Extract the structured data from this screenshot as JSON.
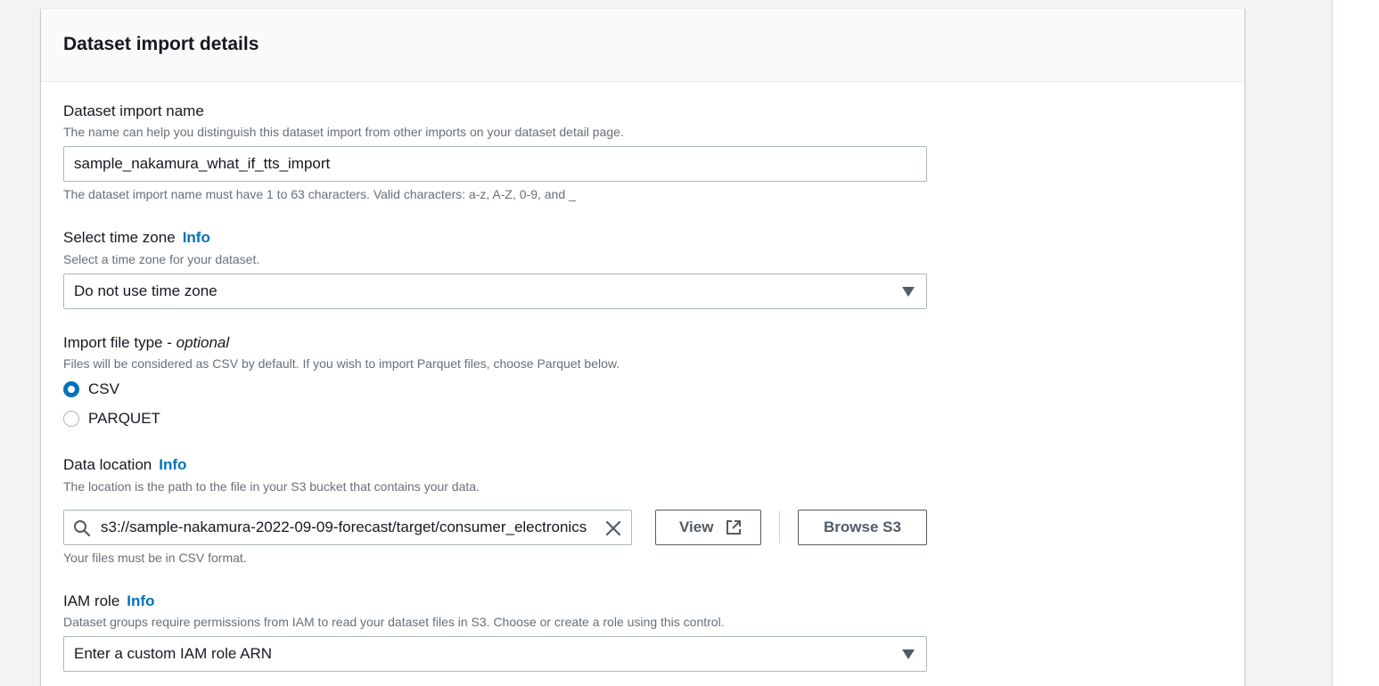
{
  "section": {
    "title": "Dataset import details"
  },
  "import_name": {
    "label": "Dataset import name",
    "description": "The name can help you distinguish this dataset import from other imports on your dataset detail page.",
    "value": "sample_nakamura_what_if_tts_import",
    "constraint": "The dataset import name must have 1 to 63 characters. Valid characters: a-z, A-Z, 0-9, and _"
  },
  "time_zone": {
    "label": "Select time zone",
    "info": "Info",
    "description": "Select a time zone for your dataset.",
    "selected": "Do not use time zone"
  },
  "file_type": {
    "label": "Import file type",
    "optional_dash": " - ",
    "optional": "optional",
    "description": "Files will be considered as CSV by default. If you wish to import Parquet files, choose Parquet below.",
    "options": [
      {
        "label": "CSV",
        "checked": true
      },
      {
        "label": "PARQUET",
        "checked": false
      }
    ]
  },
  "data_location": {
    "label": "Data location",
    "info": "Info",
    "description": "The location is the path to the file in your S3 bucket that contains your data.",
    "value": "s3://sample-nakamura-2022-09-09-forecast/target/consumer_electronics",
    "view_label": "View",
    "browse_label": "Browse S3",
    "hint": "Your files must be in CSV format."
  },
  "iam_role": {
    "label": "IAM role",
    "info": "Info",
    "description": "Dataset groups require permissions from IAM to read your dataset files in S3. Choose or create a role using this control.",
    "selected": "Enter a custom IAM role ARN"
  },
  "colors": {
    "link": "#0073bb",
    "radio_checked": "#0073bb",
    "border": "#aab7b8",
    "text": "#16191f",
    "muted_text": "#687078",
    "page_bg": "#f2f3f3"
  },
  "icons": [
    "search-icon",
    "clear-icon",
    "external-link-icon",
    "caret-down-icon"
  ]
}
